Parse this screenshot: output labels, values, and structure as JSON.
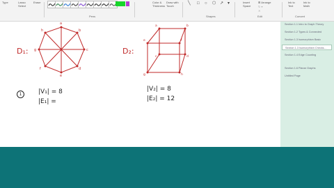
{
  "ribbon": {
    "tools": {
      "type": "Type",
      "lasso": "Lasso\nSelect",
      "erase": "Erase"
    },
    "color_thickness": "Color &\nThickness",
    "draw_touch": "Draw with\nTouch",
    "insert_space": "Insert\nSpace",
    "arrange": "Arrange",
    "ink_to_text": "Ink to\nText",
    "ink_to_math": "Ink to\nMath",
    "groups": {
      "pens": "Pens",
      "shapes": "Shapes",
      "edit": "Edit",
      "convert": "Convert"
    },
    "pen_colors": [
      "#222222",
      "#1d7a3a",
      "#1c6ed4",
      "#333333",
      "#7a3bd1",
      "#2a2a2a",
      "#222222",
      "#1b1b1b",
      "#444444"
    ],
    "swatch_colors": [
      "#17d62b",
      "#b43ad2"
    ]
  },
  "canvas": {
    "label_d1": "D₁:",
    "label_d2": "D₂:",
    "circled_num": "1",
    "v1": "|V₁| = 8",
    "e1": "|E₁| =",
    "v2": "|V₂| = 8",
    "e2": "|E₂| = 12",
    "octagon_labels": [
      "a",
      "b",
      "c",
      "d",
      "e",
      "f",
      "g",
      "h"
    ],
    "cube_labels": [
      "a",
      "b",
      "c",
      "d",
      "e",
      "f",
      "g",
      "h"
    ],
    "ink_color": "#c02a2a"
  },
  "pages": [
    "Section 1.1 Intro to Graph Theory",
    "Section 1.2 Types & Connected",
    "Section 1.3 Isomorphism Basic",
    "Section 1.3 Isomorphism Checks...",
    "Section 1.4 Edge Counting",
    "Section 1.6 Planar Graphs",
    "Untitled Page"
  ]
}
